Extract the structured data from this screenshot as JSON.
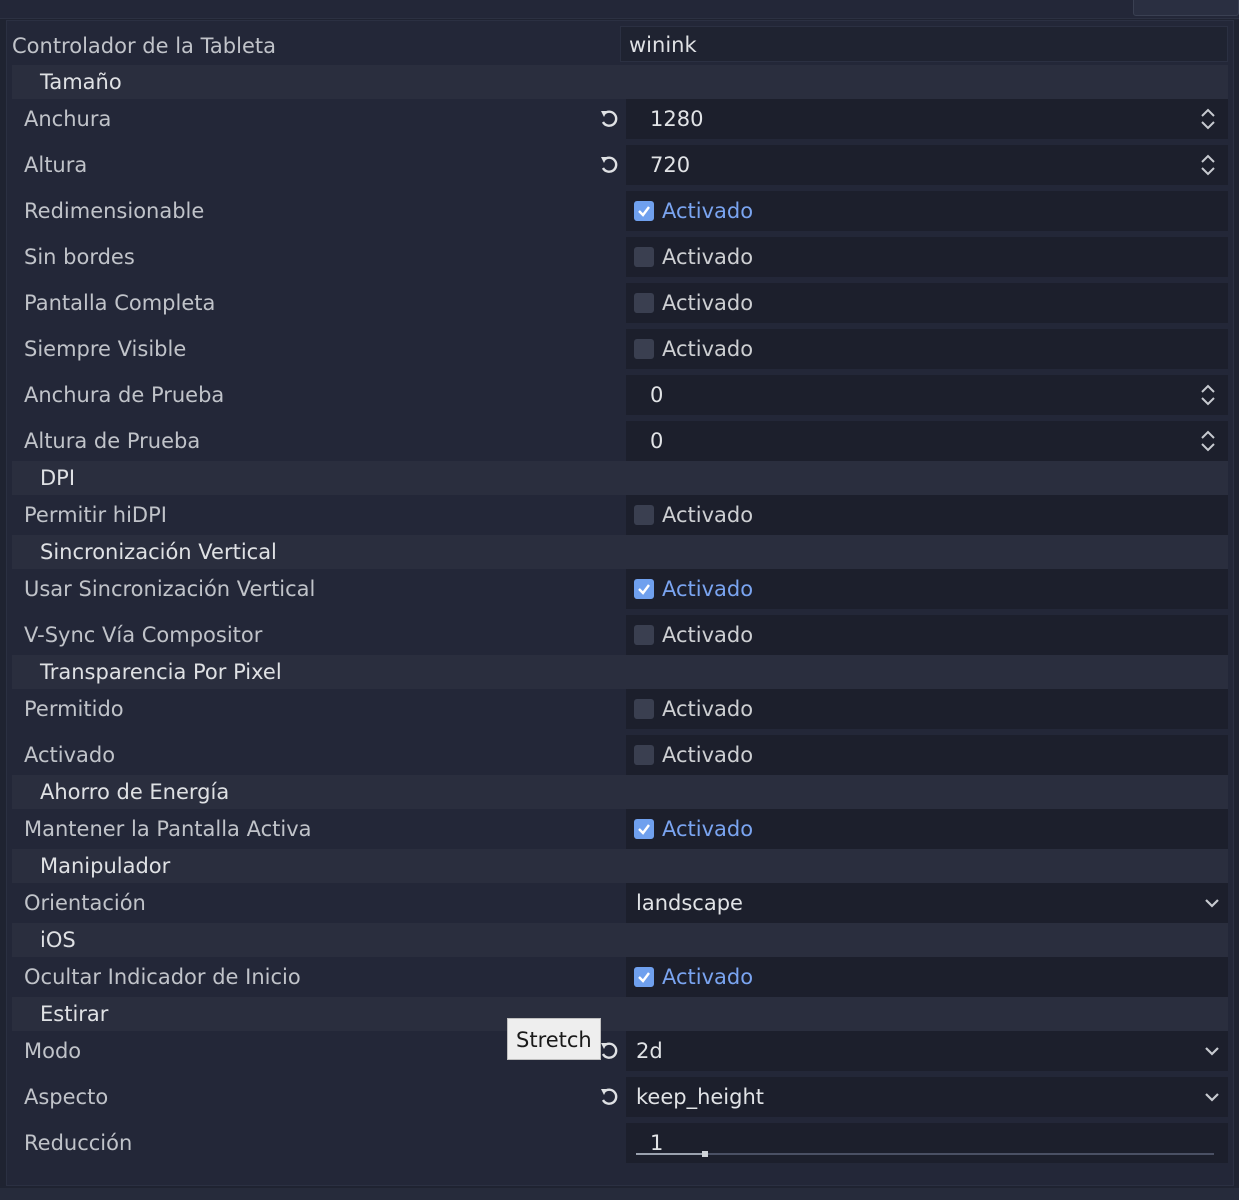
{
  "colors": {
    "background": "#1f2331",
    "checkbox_on": "#6fa0ee",
    "checked_text": "#7aa4f0",
    "section_bg": "#2a2e3e"
  },
  "tablet_driver": {
    "label": "Controlador de la Tableta",
    "value": "winink"
  },
  "sections": {
    "size": "Tamaño",
    "dpi": "DPI",
    "vsync": "Sincronización Vertical",
    "per_pixel_transparency": "Transparencia Por Pixel",
    "energy_saving": "Ahorro de Energía",
    "handheld": "Manipulador",
    "ios": "iOS",
    "stretch": "Estirar"
  },
  "checkbox_text": "Activado",
  "props": {
    "width": {
      "label": "Anchura",
      "value": "1280"
    },
    "height": {
      "label": "Altura",
      "value": "720"
    },
    "resizable": {
      "label": "Redimensionable",
      "checked": true
    },
    "borderless": {
      "label": "Sin bordes",
      "checked": false
    },
    "fullscreen": {
      "label": "Pantalla Completa",
      "checked": false
    },
    "always_on_top": {
      "label": "Siempre Visible",
      "checked": false
    },
    "test_width": {
      "label": "Anchura de Prueba",
      "value": "0"
    },
    "test_height": {
      "label": "Altura de Prueba",
      "value": "0"
    },
    "allow_hidpi": {
      "label": "Permitir hiDPI",
      "checked": false
    },
    "use_vsync": {
      "label": "Usar Sincronización Vertical",
      "checked": true
    },
    "vsync_compositor": {
      "label": "V-Sync Vía Compositor",
      "checked": false
    },
    "transp_allowed": {
      "label": "Permitido",
      "checked": false
    },
    "transp_enabled": {
      "label": "Activado",
      "checked": false
    },
    "keep_screen_on": {
      "label": "Mantener la Pantalla Activa",
      "checked": true
    },
    "orientation": {
      "label": "Orientación",
      "value": "landscape"
    },
    "hide_home_indicator": {
      "label": "Ocultar Indicador de Inicio",
      "checked": true
    },
    "stretch_mode": {
      "label": "Modo",
      "value": "2d"
    },
    "stretch_aspect": {
      "label": "Aspecto",
      "value": "keep_height"
    },
    "shrink": {
      "label": "Reducción",
      "value": "1",
      "slider_fraction": 0.12
    }
  },
  "tooltip": "Stretch"
}
